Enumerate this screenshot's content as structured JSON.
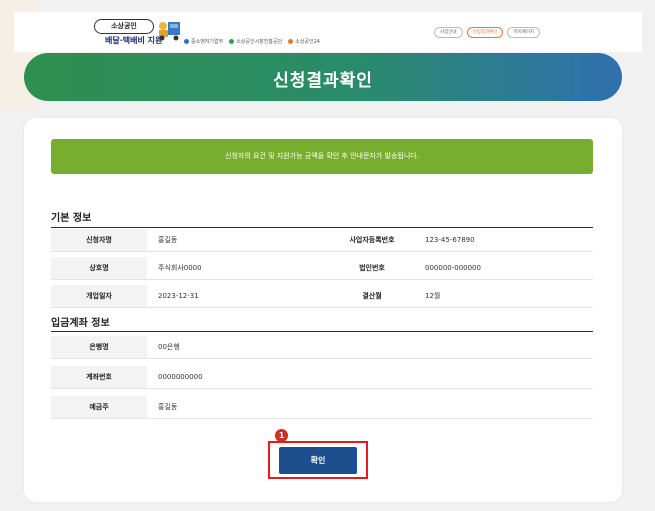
{
  "header": {
    "brand_badge": "소상공인",
    "brand_sub": "배달·택배비 지원",
    "partners": [
      "중소벤처기업부",
      "소상공인시장진흥공단",
      "소상공인24"
    ],
    "nav": [
      "사업안내",
      "신청결과확인",
      "마이페이지"
    ],
    "active_nav_index": 1,
    "accent_color": "#e07a2b"
  },
  "banner": {
    "title": "신청결과확인"
  },
  "notice": {
    "text": "신청자의 요건 및 지원가능 금액을 확인 후 안내문자가 발송됩니다."
  },
  "basic_info": {
    "title": "기본 정보",
    "rows": [
      {
        "label1": "신청자명",
        "value1": "홍길동",
        "label2": "사업자등록번호",
        "value2": "123-45-67890"
      },
      {
        "label1": "상호명",
        "value1": "주식회사0000",
        "label2": "법인번호",
        "value2": "000000-000000"
      },
      {
        "label1": "개업일자",
        "value1": "2023-12-31",
        "label2": "결산월",
        "value2": "12월"
      }
    ]
  },
  "account_info": {
    "title": "입금계좌 정보",
    "rows": [
      {
        "label": "은행명",
        "value": "00은행"
      },
      {
        "label": "계좌번호",
        "value": "0000000000"
      },
      {
        "label": "예금주",
        "value": "홍길동"
      }
    ]
  },
  "confirm": {
    "label": "확인",
    "step": "1"
  },
  "colors": {
    "banner_start": "#2e8f4f",
    "banner_end": "#2f6fb0",
    "notice_bg": "#79ad2d",
    "button": "#1d4f8f",
    "highlight": "#e21b1b"
  }
}
